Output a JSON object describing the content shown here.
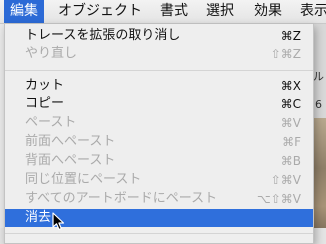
{
  "menubar": {
    "items": [
      {
        "label": "編集",
        "active": true
      },
      {
        "label": "オブジェクト"
      },
      {
        "label": "書式"
      },
      {
        "label": "選択"
      },
      {
        "label": "効果"
      },
      {
        "label": "表示"
      }
    ]
  },
  "background": {
    "chars": [
      "ル",
      "6"
    ]
  },
  "edit_menu": {
    "items": [
      {
        "label": "トレースを拡張の取り消し",
        "shortcut": "⌘Z",
        "enabled": true
      },
      {
        "label": "やり直し",
        "shortcut": "⇧⌘Z",
        "enabled": false
      },
      {
        "label": "カット",
        "shortcut": "⌘X",
        "enabled": true
      },
      {
        "label": "コピー",
        "shortcut": "⌘C",
        "enabled": true
      },
      {
        "label": "ペースト",
        "shortcut": "⌘V",
        "enabled": false
      },
      {
        "label": "前面へペースト",
        "shortcut": "⌘F",
        "enabled": false
      },
      {
        "label": "背面へペースト",
        "shortcut": "⌘B",
        "enabled": false
      },
      {
        "label": "同じ位置にペースト",
        "shortcut": "⇧⌘V",
        "enabled": false
      },
      {
        "label": "すべてのアートボードにペースト",
        "shortcut": "⌥⇧⌘V",
        "enabled": false
      },
      {
        "label": "消去",
        "shortcut": "",
        "enabled": true,
        "selected": true
      }
    ]
  }
}
